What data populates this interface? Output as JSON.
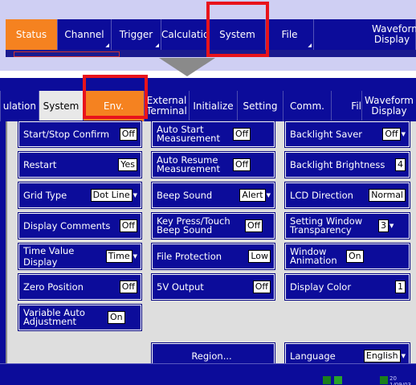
{
  "top_menu": {
    "tabs": [
      {
        "label": "Status"
      },
      {
        "label": "Channel"
      },
      {
        "label": "Trigger"
      },
      {
        "label": "Calculation"
      },
      {
        "label": "System"
      },
      {
        "label": "File"
      },
      {
        "label": "Waveform Display"
      }
    ]
  },
  "window": {
    "tabs": [
      {
        "label": "ulation"
      },
      {
        "label": "System"
      },
      {
        "label": "Env."
      },
      {
        "label": "External Terminal"
      },
      {
        "label": "Initialize"
      },
      {
        "label": "Setting"
      },
      {
        "label": "Comm."
      },
      {
        "label": "Fil"
      },
      {
        "label": "Waveform Display"
      }
    ]
  },
  "settings": {
    "start_stop_confirm": {
      "label": "Start/Stop Confirm",
      "value": "Off"
    },
    "restart": {
      "label": "Restart",
      "value": "Yes"
    },
    "grid_type": {
      "label": "Grid Type",
      "value": "Dot Line"
    },
    "display_comments": {
      "label": "Display Comments",
      "value": "Off"
    },
    "time_value_display": {
      "label": "Time Value Display",
      "value": "Time"
    },
    "zero_position": {
      "label": "Zero Position",
      "value": "Off"
    },
    "variable_auto_adjustment": {
      "label": "Variable Auto Adjustment",
      "value": "On"
    },
    "auto_start_measurement": {
      "label": "Auto Start Measurement",
      "value": "Off"
    },
    "auto_resume_measurement": {
      "label": "Auto Resume Measurement",
      "value": "Off"
    },
    "beep_sound": {
      "label": "Beep Sound",
      "value": "Alert"
    },
    "key_press_touch_beep": {
      "label": "Key Press/Touch Beep Sound",
      "value": "Off"
    },
    "file_protection": {
      "label": "File Protection",
      "value": "Low"
    },
    "five_v_output": {
      "label": "5V Output",
      "value": "Off"
    },
    "region": {
      "label": "Region..."
    },
    "backlight_saver": {
      "label": "Backlight Saver",
      "value": "Off"
    },
    "backlight_brightness": {
      "label": "Backlight Brightness",
      "value": "4"
    },
    "lcd_direction": {
      "label": "LCD Direction",
      "value": "Normal"
    },
    "setting_window_transparency": {
      "label": "Setting Window Transparency",
      "value": "3"
    },
    "window_animation": {
      "label": "Window Animation",
      "value": "On"
    },
    "display_color": {
      "label": "Display Color",
      "value": "1"
    },
    "language": {
      "label": "Language",
      "value": "English"
    }
  },
  "status_bar": {
    "date": "20 1/09/03"
  },
  "colors": {
    "panel_blue": "#0c0c9a",
    "accent_orange": "#f58220",
    "highlight_red": "#e8131b"
  },
  "icons": [
    "dropdown-arrow-icon",
    "submenu-triangle-icon"
  ]
}
